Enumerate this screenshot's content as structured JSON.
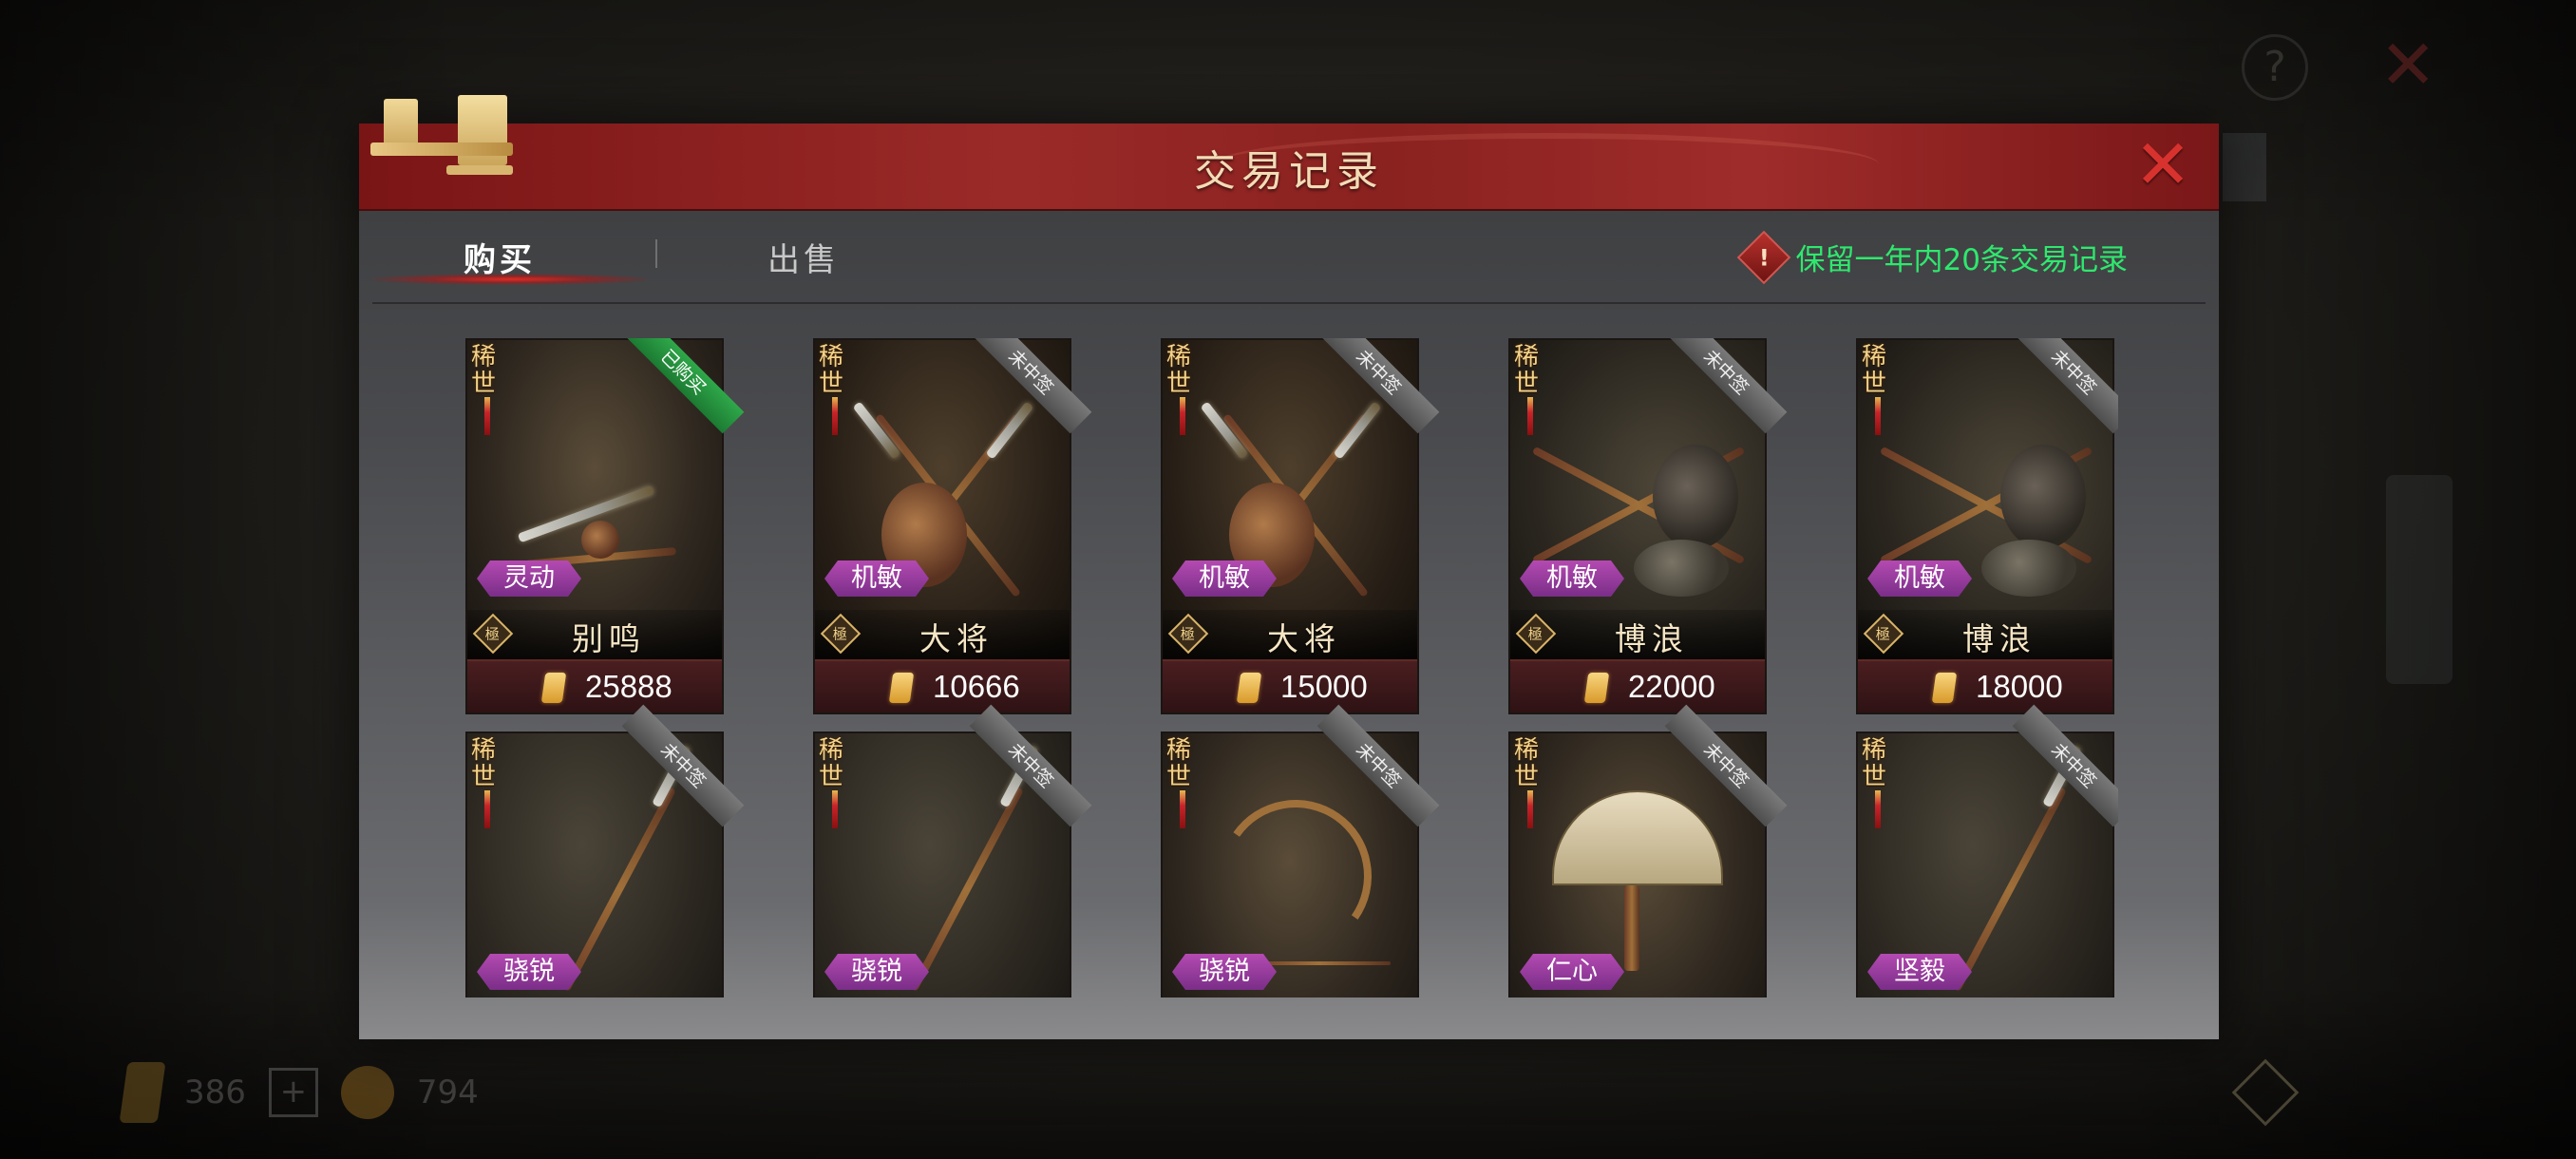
{
  "background": {
    "hud_currency_bars": "386",
    "hud_currency_coins": "794",
    "hud_plus": "+"
  },
  "modal": {
    "title": "交易记录",
    "close_label": "✕",
    "tabs": [
      {
        "label": "购买",
        "active": true
      },
      {
        "label": "出售",
        "active": false
      }
    ],
    "notice_icon": "!",
    "notice": "保留一年内20条交易记录"
  },
  "cards": [
    {
      "rarity": "稀世",
      "status": "已购买",
      "attribute": "灵动",
      "rank": "極",
      "name": "别鸣",
      "price": "25888",
      "art": "sword-icon"
    },
    {
      "rarity": "稀世",
      "status": "未中签",
      "attribute": "机敏",
      "rank": "極",
      "name": "大将",
      "price": "10666",
      "art": "axe-icon"
    },
    {
      "rarity": "稀世",
      "status": "未中签",
      "attribute": "机敏",
      "rank": "極",
      "name": "大将",
      "price": "15000",
      "art": "axe-icon"
    },
    {
      "rarity": "稀世",
      "status": "未中签",
      "attribute": "机敏",
      "rank": "極",
      "name": "博浪",
      "price": "22000",
      "art": "deer-hammer-icon"
    },
    {
      "rarity": "稀世",
      "status": "未中签",
      "attribute": "机敏",
      "rank": "極",
      "name": "博浪",
      "price": "18000",
      "art": "deer-hammer-icon"
    },
    {
      "rarity": "稀世",
      "status": "未中签",
      "attribute": "骁锐",
      "art": "spear-icon"
    },
    {
      "rarity": "稀世",
      "status": "未中签",
      "attribute": "骁锐",
      "art": "spear-icon"
    },
    {
      "rarity": "稀世",
      "status": "未中签",
      "attribute": "骁锐",
      "art": "bow-icon"
    },
    {
      "rarity": "稀世",
      "status": "未中签",
      "attribute": "仁心",
      "art": "fan-icon"
    },
    {
      "rarity": "稀世",
      "status": "未中签",
      "attribute": "坚毅",
      "art": "spear-icon"
    }
  ],
  "colors": {
    "header_red": "#9a2a28",
    "notice_green": "#2ee86e",
    "bought_green": "#2fa84a",
    "attribute_purple": "#b44ab2",
    "price_bar": "#4a1e20"
  }
}
